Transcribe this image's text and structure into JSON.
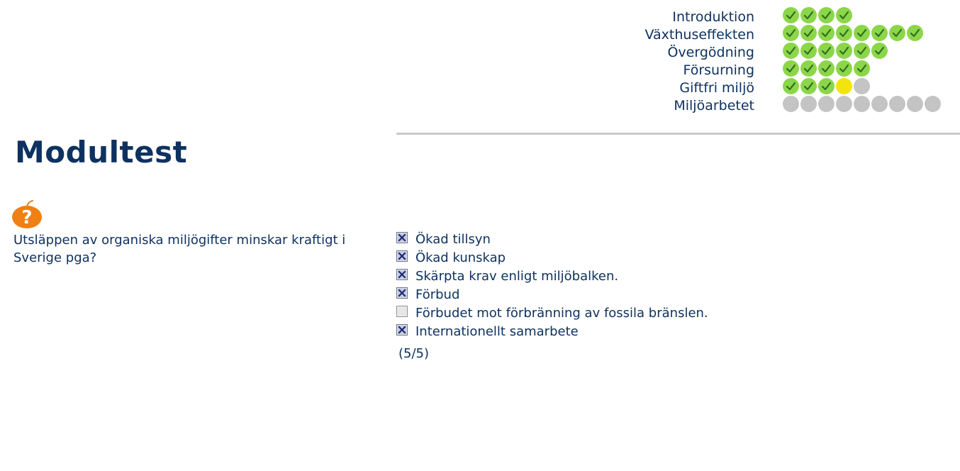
{
  "progress": {
    "modules": [
      {
        "label": "Introduktion",
        "states": [
          "done",
          "done",
          "done",
          "done"
        ]
      },
      {
        "label": "Växthuseffekten",
        "states": [
          "done",
          "done",
          "done",
          "done",
          "done",
          "done",
          "done",
          "done"
        ]
      },
      {
        "label": "Övergödning",
        "states": [
          "done",
          "done",
          "done",
          "done",
          "done",
          "done"
        ]
      },
      {
        "label": "Försurning",
        "states": [
          "done",
          "done",
          "done",
          "done",
          "done"
        ]
      },
      {
        "label": "Giftfri miljö",
        "states": [
          "done",
          "done",
          "done",
          "current",
          "todo"
        ]
      },
      {
        "label": "Miljöarbetet",
        "states": [
          "todo",
          "todo",
          "todo",
          "todo",
          "todo",
          "todo",
          "todo",
          "todo",
          "todo"
        ]
      }
    ],
    "colors": {
      "done": "#8cd64a",
      "current": "#f3e410",
      "todo": "#c4c4c4",
      "check": "#2f6e1e"
    }
  },
  "page": {
    "title": "Modultest"
  },
  "question": {
    "icon": "question-mark-fruit-icon",
    "text": "Utsläppen av organiska miljögifter minskar kraftigt i Sverige pga?",
    "options": [
      {
        "label": "Ökad tillsyn",
        "checked": true
      },
      {
        "label": "Ökad kunskap",
        "checked": true
      },
      {
        "label": "Skärpta krav enligt miljöbalken.",
        "checked": true
      },
      {
        "label": "Förbud",
        "checked": true
      },
      {
        "label": "Förbudet mot förbränning av fossila bränslen.",
        "checked": false
      },
      {
        "label": "Internationellt samarbete",
        "checked": true
      }
    ],
    "score": "(5/5)"
  },
  "colors": {
    "text": "#0e3260",
    "accent_orange": "#f07f14",
    "divider": "#c9c9cd"
  }
}
